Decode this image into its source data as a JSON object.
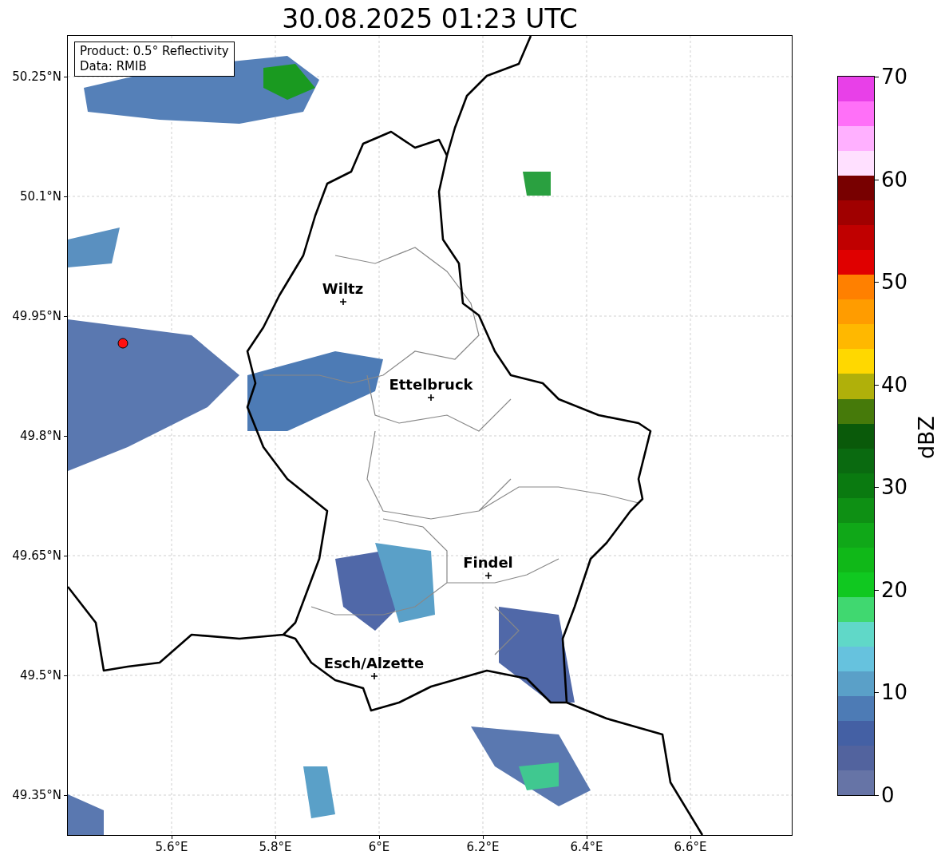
{
  "title": "30.08.2025 01:23 UTC",
  "info_box": {
    "lines": [
      "Product: 0.5° Reflectivity",
      "Data: RMIB"
    ]
  },
  "map": {
    "x_ticks": [
      "5.6°E",
      "5.8°E",
      "6°E",
      "6.2°E",
      "6.4°E",
      "6.6°E"
    ],
    "y_ticks": [
      "50.25°N",
      "50.1°N",
      "49.95°N",
      "49.8°N",
      "49.65°N",
      "49.5°N",
      "49.35°N"
    ],
    "places": [
      {
        "name": "Wiltz"
      },
      {
        "name": "Ettelbruck"
      },
      {
        "name": "Findel"
      },
      {
        "name": "Esch/Alzette"
      }
    ]
  },
  "colorbar": {
    "label": "dBZ",
    "ticks": [
      "70",
      "60",
      "50",
      "40",
      "30",
      "20",
      "10",
      "0"
    ]
  }
}
